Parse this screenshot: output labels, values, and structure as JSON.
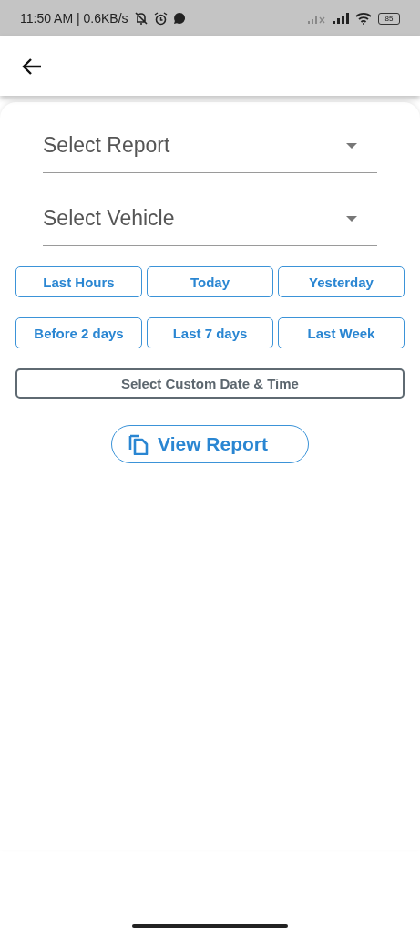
{
  "status_bar": {
    "time": "11:50 AM | 0.6KB/s",
    "battery": "85"
  },
  "dropdowns": [
    {
      "placeholder": "Select Report"
    },
    {
      "placeholder": "Select Vehicle"
    }
  ],
  "quick_ranges": [
    "Last Hours",
    "Today",
    "Yesterday",
    "Before 2 days",
    "Last 7 days",
    "Last Week"
  ],
  "custom_button": "Select Custom Date & Time",
  "view_button": "View Report"
}
